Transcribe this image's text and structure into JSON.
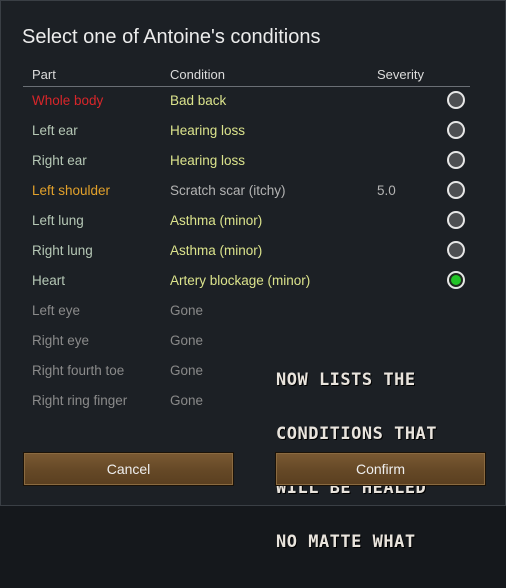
{
  "dialog": {
    "title": "Select one of Antoine's conditions",
    "columns": {
      "part": "Part",
      "condition": "Condition",
      "severity": "Severity"
    },
    "rows": [
      {
        "part": "Whole body",
        "condition": "Bad back",
        "severity": "",
        "part_color": "#d8262a",
        "condition_color": "#dbe38c",
        "selectable": true,
        "selected": false
      },
      {
        "part": "Left ear",
        "condition": "Hearing loss",
        "severity": "",
        "part_color": "#b5c7b5",
        "condition_color": "#dbe38c",
        "selectable": true,
        "selected": false
      },
      {
        "part": "Right ear",
        "condition": "Hearing loss",
        "severity": "",
        "part_color": "#b5c7b5",
        "condition_color": "#dbe38c",
        "selectable": true,
        "selected": false
      },
      {
        "part": "Left shoulder",
        "condition": "Scratch scar (itchy)",
        "severity": "5.0",
        "part_color": "#e2a12b",
        "condition_color": "#b3b3b3",
        "selectable": true,
        "selected": false
      },
      {
        "part": "Left lung",
        "condition": "Asthma (minor)",
        "severity": "",
        "part_color": "#b5c7b5",
        "condition_color": "#dbe38c",
        "selectable": true,
        "selected": false
      },
      {
        "part": "Right lung",
        "condition": "Asthma (minor)",
        "severity": "",
        "part_color": "#b5c7b5",
        "condition_color": "#dbe38c",
        "selectable": true,
        "selected": false
      },
      {
        "part": "Heart",
        "condition": "Artery blockage (minor)",
        "severity": "",
        "part_color": "#b5c7b5",
        "condition_color": "#dbe38c",
        "selectable": true,
        "selected": true
      },
      {
        "part": "Left eye",
        "condition": "Gone",
        "severity": "",
        "part_color": "#8a8a8a",
        "condition_color": "#8a8a8a",
        "selectable": false,
        "selected": false
      },
      {
        "part": "Right eye",
        "condition": "Gone",
        "severity": "",
        "part_color": "#8a8a8a",
        "condition_color": "#8a8a8a",
        "selectable": false,
        "selected": false
      },
      {
        "part": "Right fourth toe",
        "condition": "Gone",
        "severity": "",
        "part_color": "#8a8a8a",
        "condition_color": "#8a8a8a",
        "selectable": false,
        "selected": false
      },
      {
        "part": "Right ring finger",
        "condition": "Gone",
        "severity": "",
        "part_color": "#8a8a8a",
        "condition_color": "#8a8a8a",
        "selectable": false,
        "selected": false
      }
    ],
    "annotation": [
      "NOW LISTS THE",
      "CONDITIONS THAT",
      "WILL BE HEALED",
      "NO MATTE WHAT"
    ],
    "buttons": {
      "cancel": "Cancel",
      "confirm": "Confirm"
    }
  }
}
